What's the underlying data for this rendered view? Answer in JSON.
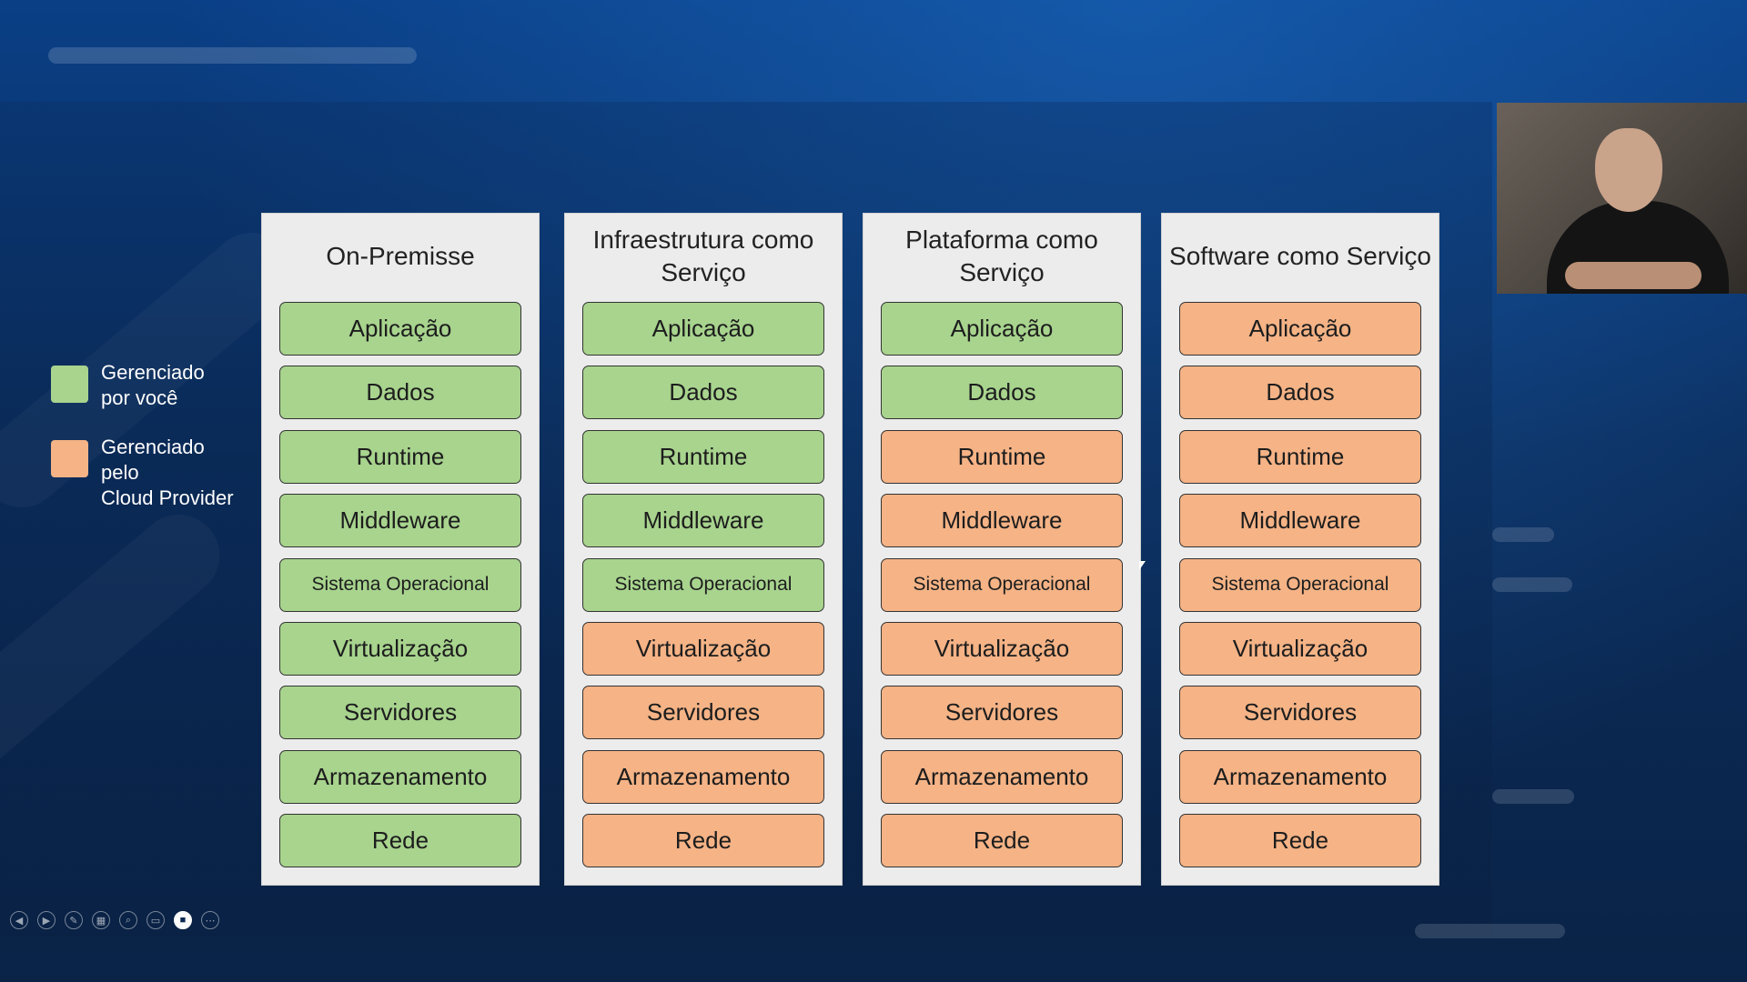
{
  "legend": {
    "items": [
      {
        "label": "Gerenciado\npor você",
        "color": "#a8d48e"
      },
      {
        "label": "Gerenciado\npelo\nCloud Provider",
        "color": "#f5b386"
      }
    ]
  },
  "colors": {
    "managed_by_you": "#a8d48e",
    "managed_by_provider": "#f5b386"
  },
  "columns": [
    {
      "title": "On-Premisse",
      "layers": [
        {
          "label": "Aplicação",
          "owner": "you"
        },
        {
          "label": "Dados",
          "owner": "you"
        },
        {
          "label": "Runtime",
          "owner": "you"
        },
        {
          "label": "Middleware",
          "owner": "you"
        },
        {
          "label": "Sistema Operacional",
          "owner": "you"
        },
        {
          "label": "Virtualização",
          "owner": "you"
        },
        {
          "label": "Servidores",
          "owner": "you"
        },
        {
          "label": "Armazenamento",
          "owner": "you"
        },
        {
          "label": "Rede",
          "owner": "you"
        }
      ]
    },
    {
      "title": "Infraestrutura como Serviço",
      "layers": [
        {
          "label": "Aplicação",
          "owner": "you"
        },
        {
          "label": "Dados",
          "owner": "you"
        },
        {
          "label": "Runtime",
          "owner": "you"
        },
        {
          "label": "Middleware",
          "owner": "you"
        },
        {
          "label": "Sistema Operacional",
          "owner": "you"
        },
        {
          "label": "Virtualização",
          "owner": "cloud"
        },
        {
          "label": "Servidores",
          "owner": "cloud"
        },
        {
          "label": "Armazenamento",
          "owner": "cloud"
        },
        {
          "label": "Rede",
          "owner": "cloud"
        }
      ]
    },
    {
      "title": "Plataforma como Serviço",
      "layers": [
        {
          "label": "Aplicação",
          "owner": "you"
        },
        {
          "label": "Dados",
          "owner": "you"
        },
        {
          "label": "Runtime",
          "owner": "cloud"
        },
        {
          "label": "Middleware",
          "owner": "cloud"
        },
        {
          "label": "Sistema Operacional",
          "owner": "cloud"
        },
        {
          "label": "Virtualização",
          "owner": "cloud"
        },
        {
          "label": "Servidores",
          "owner": "cloud"
        },
        {
          "label": "Armazenamento",
          "owner": "cloud"
        },
        {
          "label": "Rede",
          "owner": "cloud"
        }
      ]
    },
    {
      "title": "Software como Serviço",
      "layers": [
        {
          "label": "Aplicação",
          "owner": "cloud"
        },
        {
          "label": "Dados",
          "owner": "cloud"
        },
        {
          "label": "Runtime",
          "owner": "cloud"
        },
        {
          "label": "Middleware",
          "owner": "cloud"
        },
        {
          "label": "Sistema Operacional",
          "owner": "cloud"
        },
        {
          "label": "Virtualização",
          "owner": "cloud"
        },
        {
          "label": "Servidores",
          "owner": "cloud"
        },
        {
          "label": "Armazenamento",
          "owner": "cloud"
        },
        {
          "label": "Rede",
          "owner": "cloud"
        }
      ]
    }
  ],
  "presenter_controls": [
    {
      "icon": "previous-slide-icon",
      "glyph": "◀",
      "active": false
    },
    {
      "icon": "next-slide-icon",
      "glyph": "▶",
      "active": false
    },
    {
      "icon": "pen-icon",
      "glyph": "✎",
      "active": false
    },
    {
      "icon": "all-slides-icon",
      "glyph": "▦",
      "active": false
    },
    {
      "icon": "zoom-icon",
      "glyph": "⌕",
      "active": false
    },
    {
      "icon": "subtitles-icon",
      "glyph": "▭",
      "active": false
    },
    {
      "icon": "camera-icon",
      "glyph": "■",
      "active": true
    },
    {
      "icon": "more-options-icon",
      "glyph": "⋯",
      "active": false
    }
  ]
}
